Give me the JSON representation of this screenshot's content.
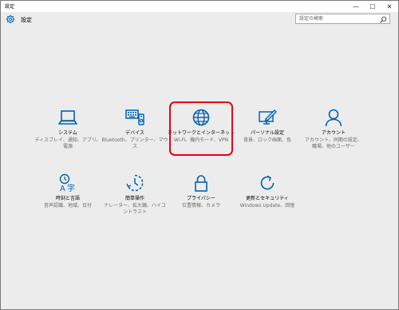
{
  "window": {
    "title": "設定",
    "minimize_glyph": "—",
    "maximize_glyph": "☐",
    "close_glyph": "✕"
  },
  "header": {
    "title": "設定",
    "icon": "gear-icon"
  },
  "search": {
    "placeholder": "設定の検索",
    "icon": "search-icon"
  },
  "accent_color": "#0063b1",
  "highlight_color": "#e60012",
  "tiles": [
    {
      "label": "システム",
      "desc": "ディスプレイ、通知、アプリ、\n電源",
      "icon": "laptop-icon"
    },
    {
      "label": "デバイス",
      "desc": "Bluetooth、プリンター、マウ\nス",
      "icon": "devices-icon"
    },
    {
      "label": "ネットワークとインターネット",
      "desc": "Wi-Fi、機内モード、VPN",
      "icon": "globe-icon"
    },
    {
      "label": "パーソナル設定",
      "desc": "背景、ロック画面、色",
      "icon": "personalization-icon"
    },
    {
      "label": "アカウント",
      "desc": "アカウント、同期の設定、\n職場、他のユーザー",
      "icon": "account-icon"
    },
    {
      "label": "時刻と言語",
      "desc": "音声認識、地域、日付",
      "icon": "time-language-icon"
    },
    {
      "label": "簡単操作",
      "desc": "ナレーター、拡大鏡、ハイコ\nントラスト",
      "icon": "ease-of-access-icon"
    },
    {
      "label": "プライバシー",
      "desc": "位置情報、カメラ",
      "icon": "lock-icon"
    },
    {
      "label": "更新とセキュリティ",
      "desc": "Windows Update、回復",
      "icon": "update-icon"
    }
  ]
}
